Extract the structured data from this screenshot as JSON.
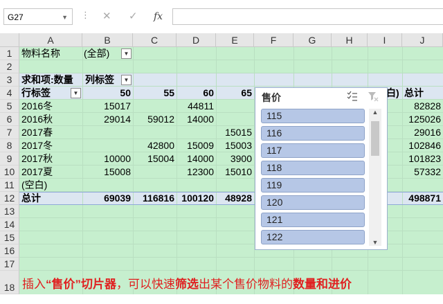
{
  "formula_bar": {
    "name_box": "G27",
    "cancel_glyph": "✕",
    "enter_glyph": "✓",
    "fx_glyph": "fx",
    "formula": ""
  },
  "columns": [
    "A",
    "B",
    "C",
    "D",
    "E",
    "F",
    "G",
    "H",
    "I",
    "J"
  ],
  "rows": [
    "1",
    "2",
    "3",
    "4",
    "5",
    "6",
    "7",
    "8",
    "9",
    "10",
    "11",
    "12",
    "13",
    "14",
    "15",
    "16",
    "17",
    "18"
  ],
  "pivot": {
    "filter_label": "物料名称",
    "filter_value": "(全部)",
    "values_label": "求和项:数量",
    "col_labels_label": "列标签",
    "row_labels_label": "行标签",
    "col_headers": [
      "50",
      "55",
      "60",
      "65"
    ],
    "col_partial": "白)",
    "total_header": "总计",
    "data_rows": [
      {
        "label": "2016冬",
        "b": "15017",
        "c": "",
        "d": "44811",
        "e": "",
        "total": "82828"
      },
      {
        "label": "2016秋",
        "b": "29014",
        "c": "59012",
        "d": "14000",
        "e": "",
        "total": "125026"
      },
      {
        "label": "2017春",
        "b": "",
        "c": "",
        "d": "",
        "e": "15015",
        "total": "29016"
      },
      {
        "label": "2017冬",
        "b": "",
        "c": "42800",
        "d": "15009",
        "e": "15003",
        "total": "102846"
      },
      {
        "label": "2017秋",
        "b": "10000",
        "c": "15004",
        "d": "14000",
        "e": "3900",
        "total": "101823"
      },
      {
        "label": "2017夏",
        "b": "15008",
        "c": "",
        "d": "12300",
        "e": "15010",
        "total": "57332"
      },
      {
        "label": "(空白)",
        "b": "",
        "c": "",
        "d": "",
        "e": "",
        "total": ""
      }
    ],
    "grand_total": {
      "label": "总计",
      "b": "69039",
      "c": "116816",
      "d": "100120",
      "e": "48928",
      "total": "498871"
    }
  },
  "slicer": {
    "title": "售价",
    "items": [
      "115",
      "116",
      "117",
      "118",
      "119",
      "120",
      "121",
      "122"
    ],
    "icons": [
      "multi-select-icon",
      "clear-filter-icon"
    ]
  },
  "caption": {
    "p1": "插入",
    "p2": "“售价”切片器",
    "p3": "，可以快速",
    "p4": "筛选",
    "p5": "出某个售价物料的",
    "p6": "数量和进价"
  },
  "colors": {
    "sheet_fill": "#c6efce",
    "header_band": "#dce6f1",
    "slicer_item": "#b6c7e6",
    "caption": "#e02020"
  }
}
